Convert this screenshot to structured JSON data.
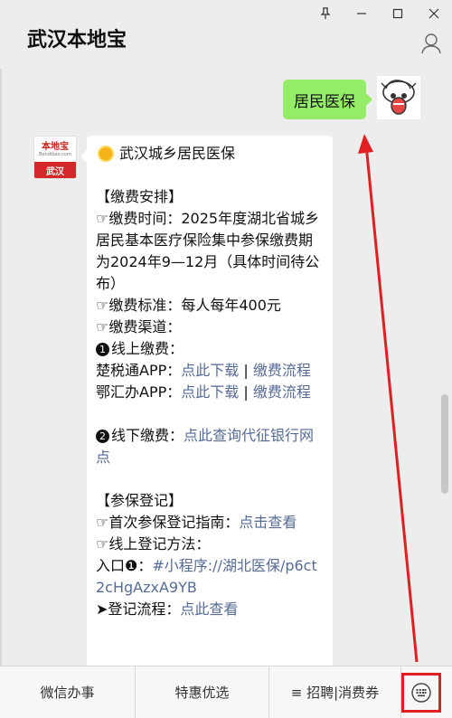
{
  "window": {
    "title": "武汉本地宝",
    "controls": [
      "pin-icon",
      "minimize-icon",
      "maximize-icon",
      "close-icon"
    ]
  },
  "chat": {
    "outgoing": {
      "text": "居民医保",
      "avatar": "cartoon-sheep-avatar"
    },
    "incoming": {
      "avatar": {
        "brand": "本地宝",
        "domain": "Bendibao.com",
        "city": "武汉"
      },
      "lines": [
        {
          "icon": "sun-icon",
          "parts": [
            {
              "t": "武汉城乡居民医保"
            }
          ]
        },
        {
          "parts": [
            {
              "t": " "
            }
          ]
        },
        {
          "parts": [
            {
              "t": "【缴费安排】"
            }
          ]
        },
        {
          "parts": [
            {
              "t": "☞缴费时间：2025年度湖北省城乡居民基本医疗保险集中参保缴费期为2024年9—12月（具体时间待公布）"
            }
          ]
        },
        {
          "parts": [
            {
              "t": "☞缴费标准：每人每年400元"
            }
          ]
        },
        {
          "parts": [
            {
              "t": "☞缴费渠道："
            }
          ]
        },
        {
          "num": "1",
          "parts": [
            {
              "t": "线上缴费："
            }
          ]
        },
        {
          "parts": [
            {
              "t": "楚税通APP："
            },
            {
              "t": "点此下载",
              "link": true
            },
            {
              "t": " | "
            },
            {
              "t": "缴费流程",
              "link": true
            }
          ]
        },
        {
          "parts": [
            {
              "t": "鄂汇办APP："
            },
            {
              "t": "点此下载",
              "link": true
            },
            {
              "t": " | "
            },
            {
              "t": "缴费流程",
              "link": true
            }
          ]
        },
        {
          "parts": [
            {
              "t": " "
            }
          ]
        },
        {
          "num": "2",
          "parts": [
            {
              "t": "线下缴费："
            },
            {
              "t": "点此查询代征银行网点",
              "link": true
            }
          ]
        },
        {
          "parts": [
            {
              "t": " "
            }
          ]
        },
        {
          "parts": [
            {
              "t": "【参保登记】"
            }
          ]
        },
        {
          "parts": [
            {
              "t": "☞首次参保登记指南："
            },
            {
              "t": "点击查看",
              "link": true
            }
          ]
        },
        {
          "parts": [
            {
              "t": "☞线上登记方法："
            }
          ]
        },
        {
          "parts": [
            {
              "t": "入口❶："
            },
            {
              "t": "#小程序://湖北医保/p6ct2cHgAzxA9YB",
              "link": true
            }
          ]
        },
        {
          "parts": [
            {
              "t": "➤登记流程："
            },
            {
              "t": "点此查看",
              "link": true
            }
          ]
        }
      ]
    }
  },
  "bottom_menu": {
    "items": [
      "微信办事",
      "特惠优选",
      "≡ 招聘|消费券"
    ],
    "keyboard_toggle": "keyboard-icon"
  },
  "colors": {
    "outgoing_bubble": "#95ec69",
    "link": "#576b95",
    "annotation_red": "#e02020",
    "avatar_red": "#d3272a"
  }
}
